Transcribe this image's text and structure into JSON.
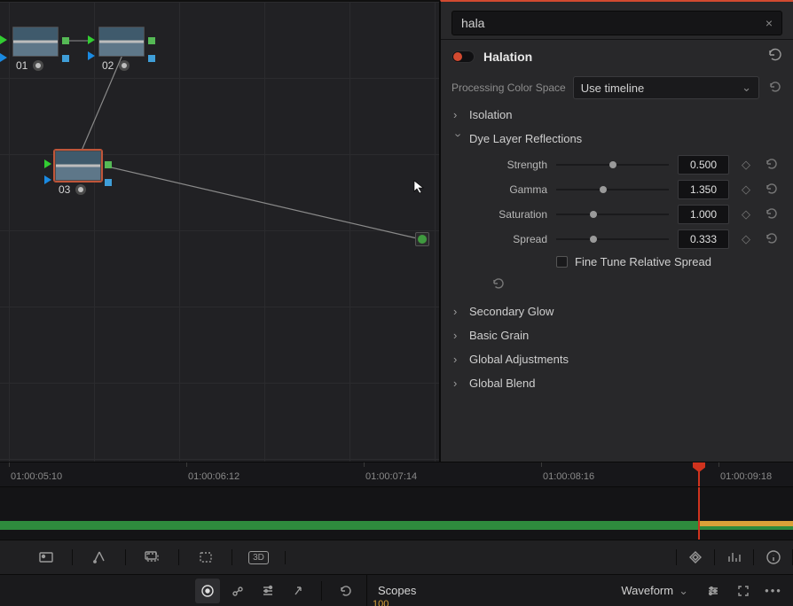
{
  "search": {
    "value": "hala"
  },
  "effect": {
    "name": "Halation",
    "enabled": true,
    "processing_space_label": "Processing Color Space",
    "processing_space_value": "Use timeline"
  },
  "sections": {
    "isolation": "Isolation",
    "dye": "Dye Layer Reflections",
    "secondary_glow": "Secondary Glow",
    "basic_grain": "Basic Grain",
    "global_adjustments": "Global Adjustments",
    "global_blend": "Global Blend"
  },
  "dye_params": {
    "strength": {
      "label": "Strength",
      "value": "0.500",
      "pos": 0.5
    },
    "gamma": {
      "label": "Gamma",
      "value": "1.350",
      "pos": 0.42
    },
    "saturation": {
      "label": "Saturation",
      "value": "1.000",
      "pos": 0.33
    },
    "spread": {
      "label": "Spread",
      "value": "0.333",
      "pos": 0.33
    },
    "fine_tune_label": "Fine Tune Relative Spread"
  },
  "nodes": {
    "n1": "01",
    "n2": "02",
    "n3": "03"
  },
  "timeline": {
    "ticks": [
      "01:00:05:10",
      "01:00:06:12",
      "01:00:07:14",
      "01:00:08:16",
      "01:00:09:18"
    ]
  },
  "scopes": {
    "title": "Scopes",
    "mode": "Waveform",
    "axis_value": "100"
  },
  "icons": {
    "clear": "×",
    "chev_right": "›",
    "chev_down": "⌄",
    "reset": "↺",
    "keyframe": "◇",
    "d3": "3D",
    "dots": "•••"
  }
}
